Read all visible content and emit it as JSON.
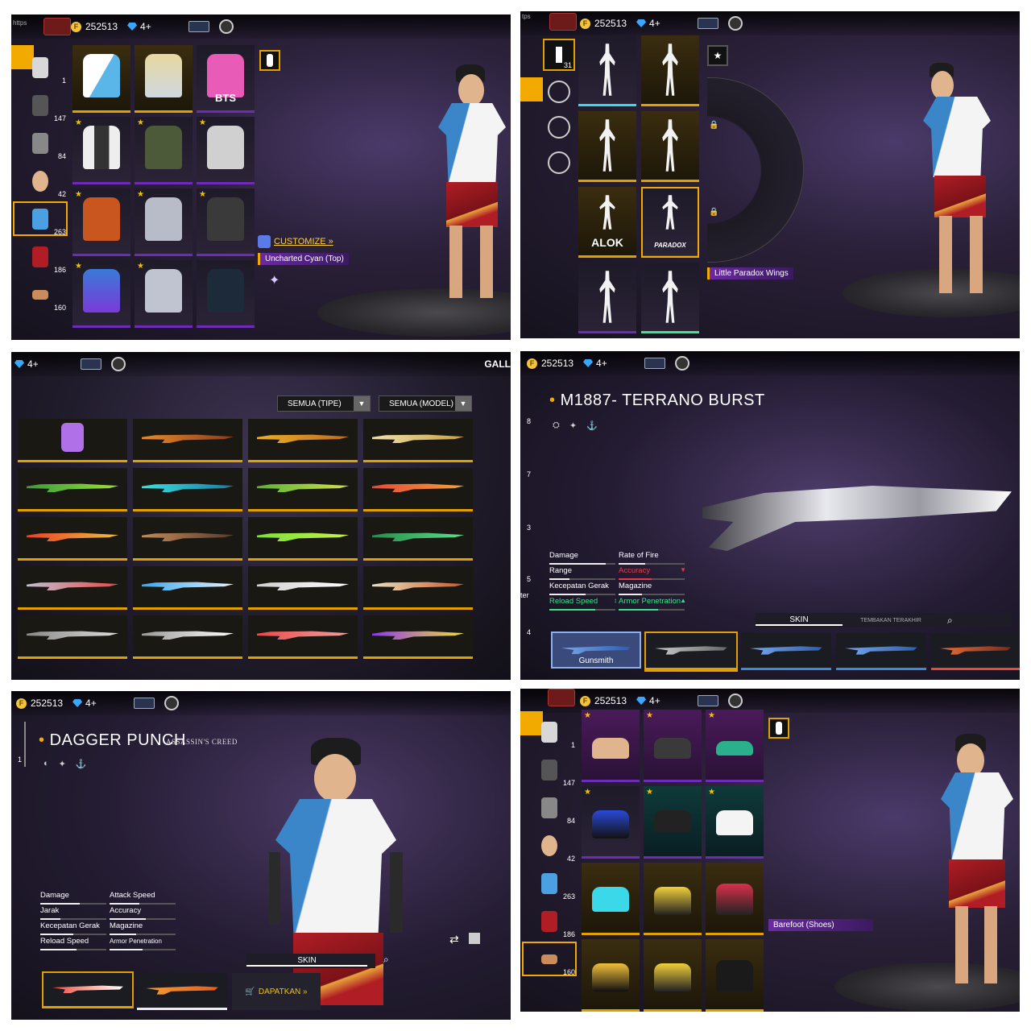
{
  "colors": {
    "accent": "#f2a900",
    "purple": "#6d2bb8",
    "gem": "#38a8ff",
    "coin": "#f3c33a"
  },
  "common": {
    "gold": "252513",
    "diamonds": "4+"
  },
  "panel1": {
    "topbar_hint": "https",
    "categories": [
      {
        "icon": "top-icon",
        "count": "1"
      },
      {
        "icon": "mask-icon",
        "count": "147"
      },
      {
        "icon": "head-icon",
        "count": "84"
      },
      {
        "icon": "face-icon",
        "count": "42"
      },
      {
        "icon": "shirt-icon",
        "count": "263"
      },
      {
        "icon": "bottom-icon",
        "count": "186"
      },
      {
        "icon": "shoe-icon",
        "count": "160"
      }
    ],
    "grid_label": "BTS",
    "customize": "CUSTOMIZE »",
    "equipped": "Uncharted Cyan (Top)"
  },
  "panel2": {
    "topbar_hint": "tps",
    "cat_count": "31",
    "alok_label": "ALOK",
    "paradox_label": "PARADOX",
    "equipped": "Little Paradox Wings"
  },
  "panel3": {
    "gallery": "GALL",
    "filter_type": "SEMUA (TIPE)",
    "filter_model": "SEMUA (MODEL)"
  },
  "panel4": {
    "title": "M1887- TERRANO BURST",
    "side_nums": [
      "8",
      "7",
      "3",
      "5",
      "4"
    ],
    "side_text": "ter",
    "stats_left": [
      {
        "label": "Damage",
        "level": 0.85
      },
      {
        "label": "Range",
        "level": 0.3
      },
      {
        "label": "Kecepatan Gerak",
        "level": 0.55
      },
      {
        "label": "Reload Speed",
        "level": 0.7,
        "value": "↕"
      }
    ],
    "stats_right": [
      {
        "label": "Rate of Fire",
        "level": 0.4
      },
      {
        "label": "Accuracy",
        "level": 0.5,
        "value": "▼"
      },
      {
        "label": "Magazine",
        "level": 0.35
      },
      {
        "label": "Armor Penetration",
        "level": 0.6,
        "value": "▲"
      }
    ],
    "tab_skin": "SKIN",
    "tab_recent": "TEMBAKAN TERAKHIR",
    "slot_label": "Gunsmith"
  },
  "panel5": {
    "title": "DAGGER PUNCH",
    "brand": "ASSASSIN'S CREED",
    "side_num": "1",
    "stats_left": [
      {
        "label": "Damage",
        "level": 0.6
      },
      {
        "label": "Jarak",
        "level": 0.3
      },
      {
        "label": "Kecepatan Gerak",
        "level": 0.5
      },
      {
        "label": "Reload Speed",
        "level": 0.55
      }
    ],
    "stats_right": [
      {
        "label": "Attack Speed",
        "level": 0.45
      },
      {
        "label": "Accuracy",
        "level": 0.55
      },
      {
        "label": "Magazine",
        "level": 0.4
      },
      {
        "label": "Armor Penetration",
        "level": 0.5
      }
    ],
    "tab_skin": "SKIN",
    "get_btn": "DAPATKAN »"
  },
  "panel6": {
    "categories": [
      {
        "icon": "top-icon",
        "count": "1"
      },
      {
        "icon": "mask-icon",
        "count": "147"
      },
      {
        "icon": "head-icon",
        "count": "84"
      },
      {
        "icon": "face-icon",
        "count": "42"
      },
      {
        "icon": "shirt-icon",
        "count": "263"
      },
      {
        "icon": "bottom-icon",
        "count": "186"
      },
      {
        "icon": "shoe-icon",
        "count": "160"
      }
    ],
    "equipped": "Barefoot (Shoes)"
  }
}
